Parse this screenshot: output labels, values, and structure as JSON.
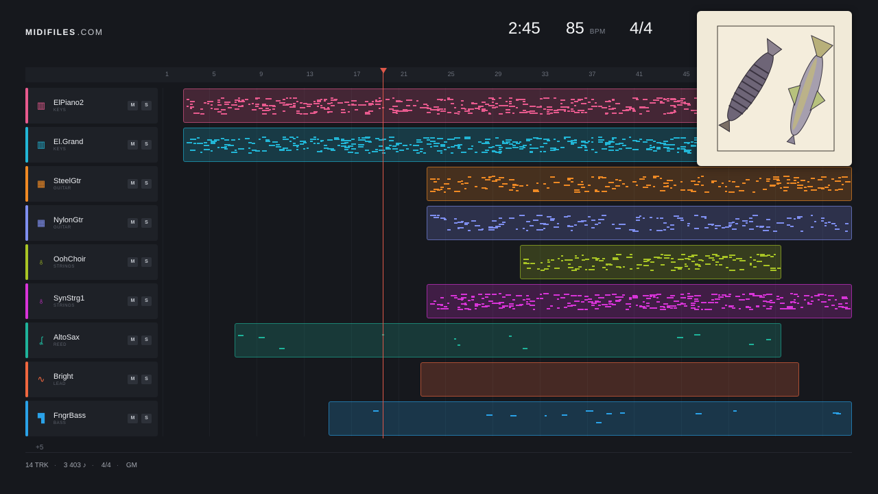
{
  "brand": {
    "name": "MIDIFILES",
    "domain": ".COM"
  },
  "transport": {
    "time": "2:45",
    "tempo": "85",
    "tempo_unit": "BPM",
    "signature": "4/4"
  },
  "ruler": {
    "bars": [
      "1",
      "5",
      "9",
      "13",
      "17",
      "21",
      "25",
      "29",
      "33",
      "37",
      "41",
      "45"
    ]
  },
  "tracks": [
    {
      "name": "ElPiano2",
      "category": "KEYS",
      "color": "#e85a8e",
      "icon": "piano-icon",
      "mute": "M",
      "solo": "S"
    },
    {
      "name": "El.Grand",
      "category": "KEYS",
      "color": "#22b6d6",
      "icon": "piano-icon",
      "mute": "M",
      "solo": "S"
    },
    {
      "name": "SteelGtr",
      "category": "GUITAR",
      "color": "#f08a24",
      "icon": "guitar-fretboard-icon",
      "mute": "M",
      "solo": "S"
    },
    {
      "name": "NylonGtr",
      "category": "GUITAR",
      "color": "#7f8ff0",
      "icon": "guitar-fretboard-icon",
      "mute": "M",
      "solo": "S"
    },
    {
      "name": "OohChoir",
      "category": "STRINGS",
      "color": "#a9c525",
      "icon": "violin-icon",
      "mute": "M",
      "solo": "S"
    },
    {
      "name": "SynStrg1",
      "category": "STRINGS",
      "color": "#d834d8",
      "icon": "violin-icon",
      "mute": "M",
      "solo": "S"
    },
    {
      "name": "AltoSax",
      "category": "REED",
      "color": "#1fb39a",
      "icon": "saxophone-icon",
      "mute": "M",
      "solo": "S"
    },
    {
      "name": "Bright",
      "category": "LEAD",
      "color": "#f0673f",
      "icon": "waveform-icon",
      "mute": "M",
      "solo": "S"
    },
    {
      "name": "FngrBass",
      "category": "BASS",
      "color": "#2aa2e8",
      "icon": "bass-icon",
      "mute": "M",
      "solo": "S"
    }
  ],
  "more_tracks": "+5",
  "footer": {
    "tracks": "14 TRK",
    "notes": "3 403 ♪",
    "signature": "4/4",
    "standard": "GM"
  },
  "artwork": {
    "description_icon": "fish-illustration-icon"
  }
}
